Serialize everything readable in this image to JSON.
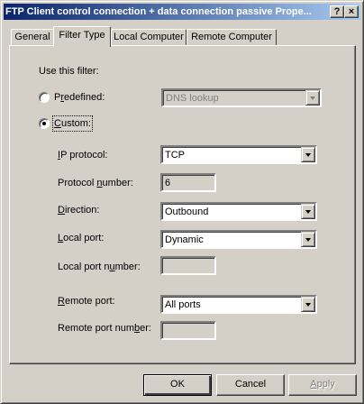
{
  "window": {
    "title": "FTP Client control connection + data connection passive Prope...",
    "help_label": "?",
    "close_label": "×"
  },
  "tabs": [
    {
      "label": "General",
      "active": false
    },
    {
      "label": "Filter Type",
      "active": true
    },
    {
      "label": "Local Computer",
      "active": false
    },
    {
      "label": "Remote Computer",
      "active": false
    }
  ],
  "filter": {
    "heading": "Use this filter:",
    "predefined": {
      "prefix": "P",
      "mnemonic": "r",
      "suffix": "edefined:",
      "selected": false,
      "value": "DNS lookup"
    },
    "custom": {
      "mnemonic": "C",
      "suffix": "ustom:",
      "selected": true
    }
  },
  "fields": {
    "ip_protocol": {
      "mnemonic": "I",
      "suffix": "P protocol:",
      "value": "TCP"
    },
    "protocol_number": {
      "prefix": "Protocol ",
      "mnemonic": "n",
      "suffix": "umber:",
      "value": "6"
    },
    "direction": {
      "mnemonic": "D",
      "suffix": "irection:",
      "value": "Outbound"
    },
    "local_port": {
      "mnemonic": "L",
      "suffix": "ocal port:",
      "value": "Dynamic"
    },
    "local_port_number": {
      "prefix": "Local port n",
      "mnemonic": "u",
      "suffix": "mber:",
      "value": ""
    },
    "remote_port": {
      "mnemonic": "R",
      "suffix": "emote port:",
      "value": "All ports"
    },
    "remote_port_number": {
      "prefix": "Remote port num",
      "mnemonic": "b",
      "suffix": "er:",
      "value": ""
    }
  },
  "buttons": {
    "ok": "OK",
    "cancel": "Cancel",
    "apply": {
      "mnemonic": "A",
      "suffix": "pply"
    }
  },
  "colors": {
    "title_start": "#0a246a",
    "title_end": "#a6caf0",
    "face": "#d4d0c8"
  }
}
